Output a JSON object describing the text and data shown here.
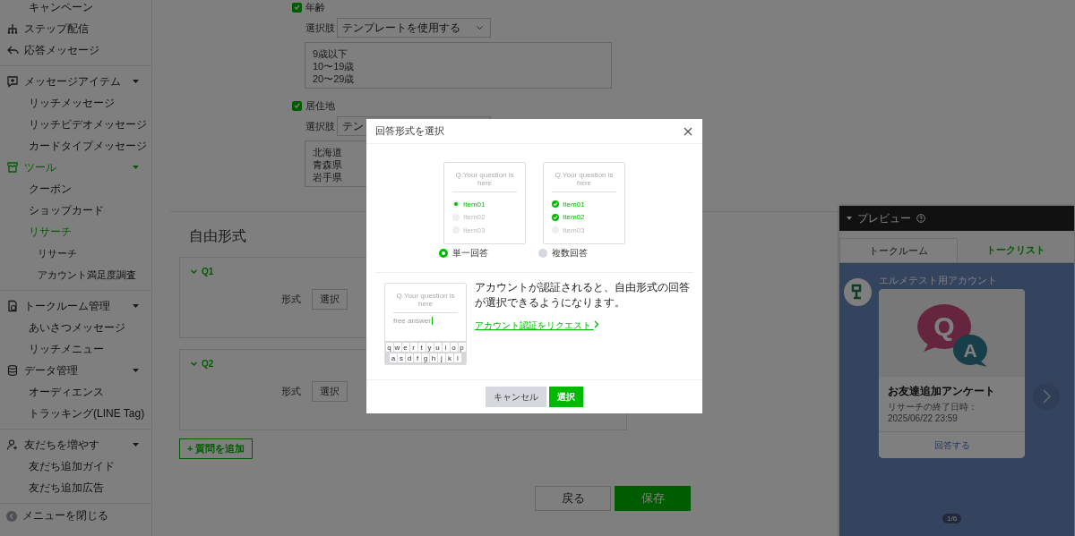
{
  "sidebar": {
    "groups": [
      [
        {
          "kind": "sub",
          "label": "キャンペーン",
          "selected": false
        },
        {
          "kind": "section",
          "label": "ステップ配信",
          "selected": false,
          "expanded": false
        },
        {
          "kind": "section",
          "label": "応答メッセージ",
          "selected": false,
          "expanded": false
        }
      ],
      [
        {
          "kind": "section",
          "label": "メッセージアイテム",
          "selected": false,
          "expanded": true,
          "children": [
            {
              "kind": "sub",
              "label": "リッチメッセージ",
              "selected": false
            },
            {
              "kind": "sub",
              "label": "リッチビデオメッセージ",
              "selected": false
            },
            {
              "kind": "sub",
              "label": "カードタイプメッセージ",
              "selected": false
            }
          ]
        },
        {
          "kind": "section",
          "label": "ツール",
          "selected": true,
          "expanded": true,
          "children": [
            {
              "kind": "sub",
              "label": "クーポン",
              "selected": false
            },
            {
              "kind": "sub",
              "label": "ショップカード",
              "selected": false
            },
            {
              "kind": "sub",
              "label": "リサーチ",
              "selected": true,
              "children": [
                {
                  "kind": "sub",
                  "label": "リサーチ",
                  "selected": false
                },
                {
                  "kind": "sub",
                  "label": "アカウント満足度調査",
                  "selected": false
                }
              ]
            }
          ]
        }
      ],
      [
        {
          "kind": "section",
          "label": "トークルーム管理",
          "selected": false,
          "expanded": true,
          "children": [
            {
              "kind": "sub",
              "label": "あいさつメッセージ",
              "selected": false
            },
            {
              "kind": "sub",
              "label": "リッチメニュー",
              "selected": false
            }
          ]
        },
        {
          "kind": "section",
          "label": "データ管理",
          "selected": false,
          "expanded": true,
          "children": [
            {
              "kind": "sub",
              "label": "オーディエンス",
              "selected": false
            },
            {
              "kind": "sub",
              "label": "トラッキング(LINE Tag)",
              "selected": false
            }
          ]
        }
      ],
      [
        {
          "kind": "section",
          "label": "友だちを増やす",
          "selected": false,
          "expanded": true,
          "children": [
            {
              "kind": "sub",
              "label": "友だち追加ガイド",
              "selected": false
            },
            {
              "kind": "sub",
              "label": "友だち追加広告",
              "selected": false
            }
          ]
        }
      ]
    ],
    "footer": {
      "label": "メニューを閉じる"
    }
  },
  "filters": [
    {
      "label": "年齢",
      "checked": true,
      "select_label": "選択肢",
      "select_value": "テンプレートを使用する",
      "options": [
        "9歳以下",
        "10〜19歳",
        "20〜29歳"
      ]
    },
    {
      "label": "居住地",
      "checked": true,
      "select_label": "選択肢",
      "select_value": "テン",
      "options": [
        "北海道",
        "青森県",
        "岩手県"
      ]
    }
  ],
  "free_form": {
    "heading": "自由形式",
    "questions": [
      {
        "label": "Q1",
        "expanded": true,
        "field_label": "形式",
        "button": "選択"
      },
      {
        "label": "Q2",
        "expanded": true,
        "field_label": "形式",
        "button": "選択"
      }
    ],
    "add_button": "+ 質問を追加"
  },
  "actions": [
    {
      "label": "戻る",
      "kind": "secondary"
    },
    {
      "label": "保存",
      "kind": "primary"
    }
  ],
  "preview": {
    "title": "プレビュー",
    "tabs": [
      {
        "label": "トークルーム",
        "selected": true
      },
      {
        "label": "トークリスト",
        "selected": false
      }
    ],
    "sender": "エルメテスト用アカウント",
    "card": {
      "image_letters": [
        "Q",
        "A"
      ],
      "title": "お友達追加アンケート",
      "subtitle": "リサーチの終了日時：",
      "date": "2025/06/22 23:59",
      "action": "回答する"
    },
    "page_indicator": "1/6"
  },
  "dialog": {
    "title": "回答形式を選択",
    "options": [
      {
        "kind": "single",
        "question": "Q.Your question is here",
        "items": [
          {
            "label": "Item01",
            "checked": true
          },
          {
            "label": "Item02",
            "checked": false
          },
          {
            "label": "Item03",
            "checked": false
          }
        ],
        "label": "単一回答",
        "selected": true
      },
      {
        "kind": "multiple",
        "question": "Q.Your question is here",
        "items": [
          {
            "label": "Item01",
            "checked": true
          },
          {
            "label": "Item02",
            "checked": true
          },
          {
            "label": "Item03",
            "checked": false
          }
        ],
        "label": "複数回答",
        "selected": false
      }
    ],
    "free_answer": {
      "question": "Q.Your question is here",
      "answer": "free answer",
      "keyboard_rows": [
        [
          "q",
          "w",
          "e",
          "r",
          "t",
          "y",
          "u",
          "i",
          "o",
          "p"
        ],
        [
          "a",
          "s",
          "d",
          "f",
          "g",
          "h",
          "j",
          "k",
          "l"
        ]
      ],
      "message": "アカウントが認証されると、自由形式の回答が選択できるようになります。",
      "link": "アカウント認証をリクエスト"
    },
    "buttons": [
      {
        "label": "キャンセル",
        "kind": "secondary"
      },
      {
        "label": "選択",
        "kind": "primary"
      }
    ]
  }
}
